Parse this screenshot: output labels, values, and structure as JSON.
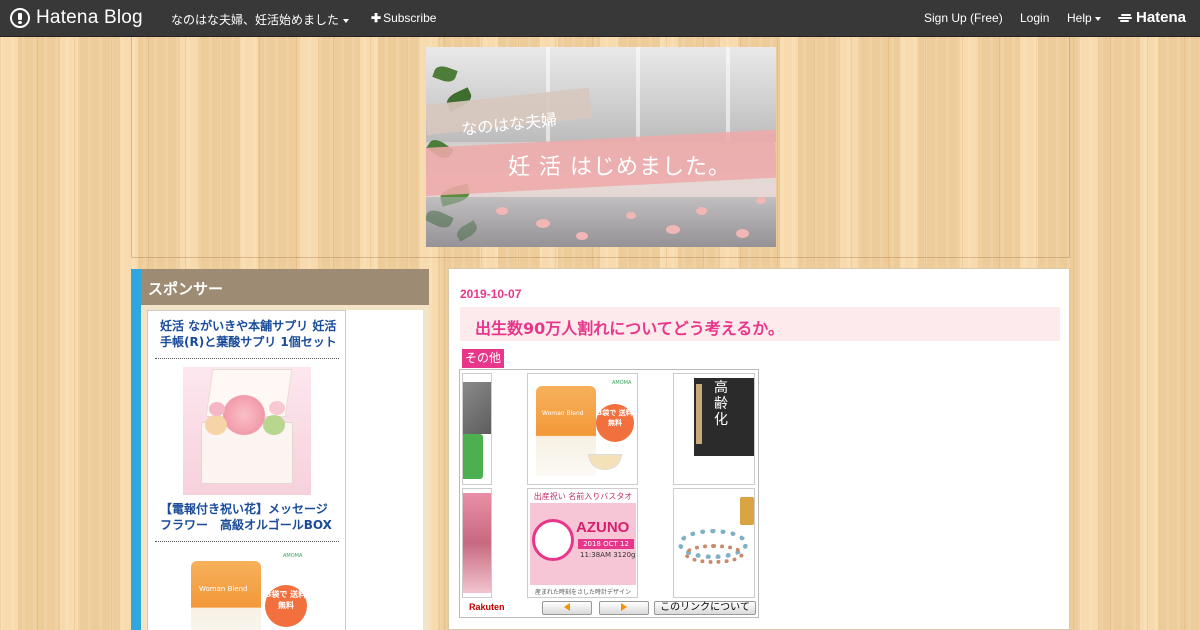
{
  "globalheader": {
    "logo_text": "Hatena Blog",
    "blog_name": "なのはな夫婦、妊活始めました",
    "subscribe_label": "Subscribe",
    "signup_label": "Sign Up (Free)",
    "login_label": "Login",
    "help_label": "Help",
    "hatena_label": "Hatena"
  },
  "banner": {
    "line1": "なのはな夫婦",
    "line2": "妊 活 はじめました。"
  },
  "sidebar": {
    "heading": "スポンサー",
    "ads": [
      {
        "title": "妊活 ながいきや本舗サプリ 妊活手帳(R)と葉酸サプリ 1個セット"
      },
      {
        "title": "【電報付き祝い花】メッセージフラワー　高級オルゴールBOX"
      }
    ],
    "ad_pack_brand": "AMOMA",
    "ad_pack_name": "Woman Blend",
    "ad_pack_badge": "3袋で 送料 無料"
  },
  "entry": {
    "date": "2019-10-07",
    "title": "出生数90万人割れについてどう考えるか。",
    "category": "その他"
  },
  "rakuten": {
    "logo": "Rakuten",
    "book_title": "高齢化",
    "towel_heading": "出産祝い 名前入りバスタオル",
    "towel_name": "AZUNO",
    "towel_date": "2018 OCT 12",
    "towel_time": "11:38AM 3120g",
    "towel_caption": "産まれた時刻をさした時計デザイン",
    "pack_brand": "AMOMA",
    "pack_name": "Woman Blend",
    "pack_badge": "3袋で 送料 無料",
    "about_label": "このリンクについて"
  }
}
